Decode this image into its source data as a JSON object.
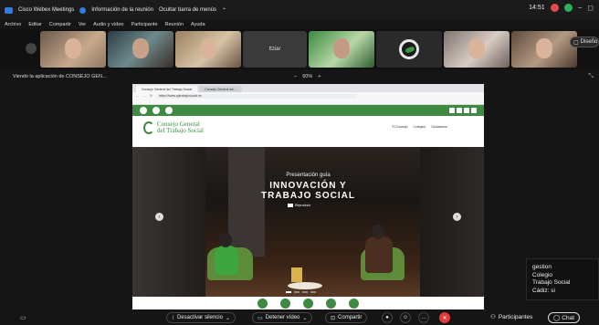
{
  "titlebar": {
    "app_title": "Cisco Webex Meetings",
    "meeting_info": "Información de la reunión",
    "hide_menu": "Ocultar barra de menús",
    "time": "14:51"
  },
  "menu": [
    "Archivo",
    "Editar",
    "Compartir",
    "Ver",
    "Audio y vídeo",
    "Participante",
    "Reunión",
    "Ayuda"
  ],
  "participants": {
    "tile4_label": "Itziar"
  },
  "design_button": "Diseño",
  "sharebar": {
    "viewing": "Viendo la aplicación de CONSEJO GEN...",
    "zoom_minus": "−",
    "zoom_value": "60%",
    "zoom_plus": "+"
  },
  "browser": {
    "tab1": "Consejo General del Trabajo Social",
    "tab2": "Consejo General del...",
    "url": "https://www.cgtrabajosocial.es"
  },
  "site": {
    "brand_line1": "Consejo General",
    "brand_line2": "del Trabajo Social",
    "nav": [
      "El Consejo",
      "Colegios",
      "Ciudadanía"
    ],
    "hero_subtitle": "Presentación guía",
    "hero_title_line1": "INNOVACIÓN Y",
    "hero_title_line2": "TRABAJO SOCIAL",
    "hero_play": "Reproducir"
  },
  "chat_overlay": [
    "gestion",
    "Colegio",
    "Trabajo Social",
    "Cádiz: si"
  ],
  "controls": {
    "mute": "Desactivar silencio",
    "stop_video": "Detener vídeo",
    "share": "Compartir",
    "participants": "Participantes",
    "chat": "Chat"
  }
}
